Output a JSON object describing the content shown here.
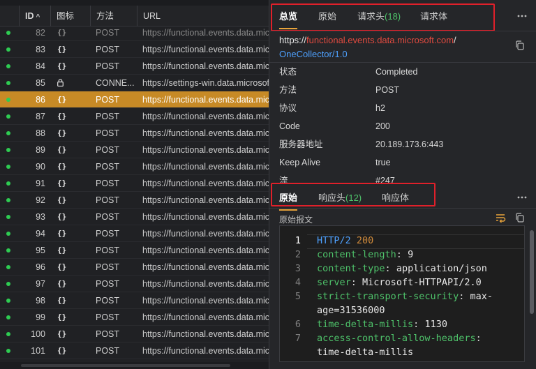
{
  "list": {
    "columns": {
      "id": "ID",
      "icon": "图标",
      "method": "方法",
      "url": "URL"
    },
    "sort_indicator": "^",
    "rows": [
      {
        "id": "82",
        "icon": "{}",
        "method": "POST",
        "url": "https://functional.events.data.microsoft.com"
      },
      {
        "id": "83",
        "icon": "{}",
        "method": "POST",
        "url": "https://functional.events.data.microsoft.com"
      },
      {
        "id": "84",
        "icon": "{}",
        "method": "POST",
        "url": "https://functional.events.data.microsoft.com"
      },
      {
        "id": "85",
        "icon": "lock",
        "method": "CONNE...",
        "url": "https://settings-win.data.microsoft.com"
      },
      {
        "id": "86",
        "icon": "{}",
        "method": "POST",
        "url": "https://functional.events.data.microsoft.com"
      },
      {
        "id": "87",
        "icon": "{}",
        "method": "POST",
        "url": "https://functional.events.data.microsoft.com"
      },
      {
        "id": "88",
        "icon": "{}",
        "method": "POST",
        "url": "https://functional.events.data.microsoft.com"
      },
      {
        "id": "89",
        "icon": "{}",
        "method": "POST",
        "url": "https://functional.events.data.microsoft.com"
      },
      {
        "id": "90",
        "icon": "{}",
        "method": "POST",
        "url": "https://functional.events.data.microsoft.com"
      },
      {
        "id": "91",
        "icon": "{}",
        "method": "POST",
        "url": "https://functional.events.data.microsoft.com"
      },
      {
        "id": "92",
        "icon": "{}",
        "method": "POST",
        "url": "https://functional.events.data.microsoft.com"
      },
      {
        "id": "93",
        "icon": "{}",
        "method": "POST",
        "url": "https://functional.events.data.microsoft.com"
      },
      {
        "id": "94",
        "icon": "{}",
        "method": "POST",
        "url": "https://functional.events.data.microsoft.com"
      },
      {
        "id": "95",
        "icon": "{}",
        "method": "POST",
        "url": "https://functional.events.data.microsoft.com"
      },
      {
        "id": "96",
        "icon": "{}",
        "method": "POST",
        "url": "https://functional.events.data.microsoft.com"
      },
      {
        "id": "97",
        "icon": "{}",
        "method": "POST",
        "url": "https://functional.events.data.microsoft.com"
      },
      {
        "id": "98",
        "icon": "{}",
        "method": "POST",
        "url": "https://functional.events.data.microsoft.com"
      },
      {
        "id": "99",
        "icon": "{}",
        "method": "POST",
        "url": "https://functional.events.data.microsoft.com"
      },
      {
        "id": "100",
        "icon": "{}",
        "method": "POST",
        "url": "https://functional.events.data.microsoft.com"
      },
      {
        "id": "101",
        "icon": "{}",
        "method": "POST",
        "url": "https://functional.events.data.microsoft.com"
      }
    ],
    "selected_id": "86",
    "status_color": "#2ecc52",
    "selected_color": "#c78a26"
  },
  "request": {
    "tabs": [
      {
        "label": "总览",
        "count": ""
      },
      {
        "label": "原始",
        "count": ""
      },
      {
        "label": "请求头",
        "count": "(18)"
      },
      {
        "label": "请求体",
        "count": ""
      }
    ],
    "url_prefix": "https://",
    "url_host": "functional.events.data.microsoft.com",
    "url_slash": "/",
    "url_path": "OneCollector/1.0",
    "fields": [
      {
        "key": "状态",
        "value": "Completed"
      },
      {
        "key": "方法",
        "value": "POST"
      },
      {
        "key": "协议",
        "value": "h2"
      },
      {
        "key": "Code",
        "value": "200"
      },
      {
        "key": "服务器地址",
        "value": "20.189.173.6:443"
      },
      {
        "key": "Keep Alive",
        "value": "true"
      },
      {
        "key": "流",
        "value": "#247"
      }
    ]
  },
  "response": {
    "tabs": [
      {
        "label": "原始",
        "count": ""
      },
      {
        "label": "响应头",
        "count": "(12)"
      },
      {
        "label": "响应体",
        "count": ""
      }
    ],
    "raw_label": "原始报文",
    "line_numbers": [
      "1",
      "2",
      "3",
      "4",
      "5",
      "",
      "6",
      "7",
      ""
    ],
    "status_line": {
      "protocol": "HTTP/2",
      "code": "200"
    },
    "headers": [
      {
        "key": "content-length",
        "value": "9"
      },
      {
        "key": "content-type",
        "value": "application/json"
      },
      {
        "key": "server",
        "value": "Microsoft-HTTPAPI/2.0"
      },
      {
        "key": "strict-transport-security",
        "value": "max-"
      },
      {
        "key": "",
        "value": "age=31536000"
      },
      {
        "key": "time-delta-millis",
        "value": "1130"
      },
      {
        "key": "access-control-allow-headers",
        "value": ""
      },
      {
        "key": "",
        "value": "time-delta-millis"
      }
    ]
  },
  "ui": {
    "more_icon": "ellipsis-icon",
    "highlight_color": "#e0202a",
    "accent": "#e8a33a",
    "count_color": "#4ec26a",
    "host_color": "#e04a3f",
    "path_color": "#4ea1ff"
  }
}
